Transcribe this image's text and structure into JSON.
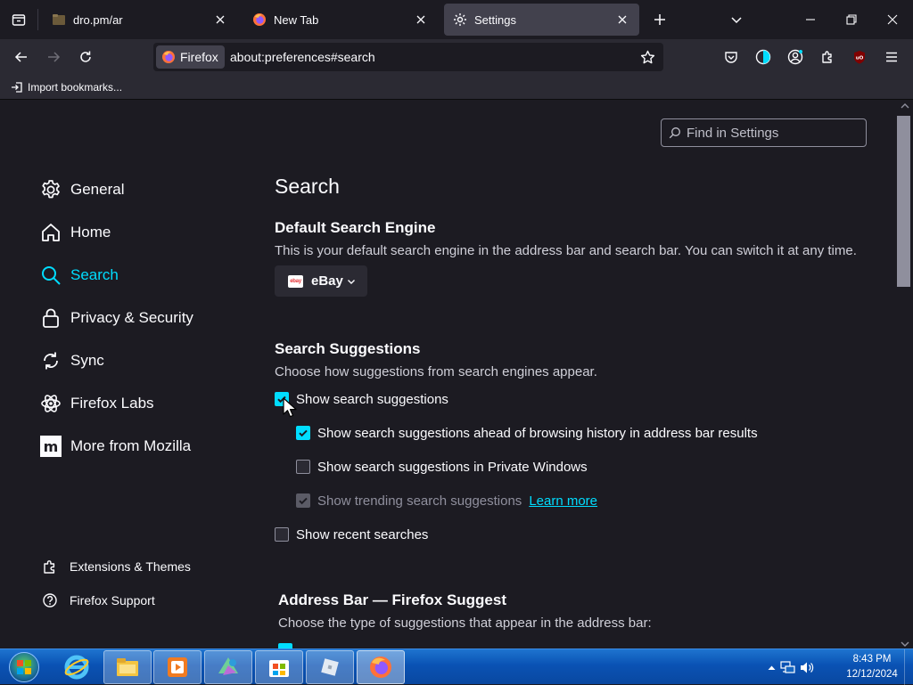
{
  "tabs": [
    {
      "label": "dro.pm/ar",
      "icon": "folder-page-icon",
      "selected": false
    },
    {
      "label": "New Tab",
      "icon": "firefox-icon",
      "selected": false
    },
    {
      "label": "Settings",
      "icon": "gear-icon",
      "selected": true
    }
  ],
  "navbar": {
    "identity_label": "Firefox",
    "url": "about:preferences#search"
  },
  "bookmarks": {
    "import_label": "Import bookmarks..."
  },
  "find": {
    "placeholder": "Find in Settings"
  },
  "categories": [
    {
      "label": "General",
      "icon": "gear-icon",
      "selected": false
    },
    {
      "label": "Home",
      "icon": "home-icon",
      "selected": false
    },
    {
      "label": "Search",
      "icon": "search-icon",
      "selected": true
    },
    {
      "label": "Privacy & Security",
      "icon": "lock-icon",
      "selected": false
    },
    {
      "label": "Sync",
      "icon": "sync-icon",
      "selected": false
    },
    {
      "label": "Firefox Labs",
      "icon": "labs-icon",
      "selected": false
    },
    {
      "label": "More from Mozilla",
      "icon": "mozilla-icon",
      "selected": false
    }
  ],
  "footer": {
    "extensions_label": "Extensions & Themes",
    "support_label": "Firefox Support"
  },
  "main": {
    "title": "Search",
    "default_engine": {
      "heading": "Default Search Engine",
      "description": "This is your default search engine in the address bar and search bar. You can switch it at any time.",
      "selected_engine": "eBay",
      "engine_logo_text": "ebay"
    },
    "suggestions": {
      "heading": "Search Suggestions",
      "description": "Choose how suggestions from search engines appear.",
      "show_suggestions": {
        "label": "Show search suggestions",
        "checked": true
      },
      "ahead_of_history": {
        "label": "Show search suggestions ahead of browsing history in address bar results",
        "checked": true
      },
      "private_windows": {
        "label": "Show search suggestions in Private Windows",
        "checked": false
      },
      "trending": {
        "label": "Show trending search suggestions",
        "checked": true,
        "disabled": true,
        "link": "Learn more"
      },
      "recent": {
        "label": "Show recent searches",
        "checked": false
      }
    },
    "address_bar": {
      "heading": "Address Bar — Firefox Suggest",
      "description": "Choose the type of suggestions that appear in the address bar:"
    }
  },
  "taskbar": {
    "apps": [
      "internet-explorer-icon",
      "file-explorer-icon",
      "media-player-icon",
      "paint-app-icon",
      "microsoft-store-icon",
      "roblox-icon",
      "firefox-icon"
    ],
    "time": "8:43 PM",
    "date": "12/12/2024"
  },
  "colors": {
    "accent": "#00ddff",
    "background": "#1c1b22",
    "toolbar": "#2b2a33",
    "taskbar": "#0a52b4"
  }
}
